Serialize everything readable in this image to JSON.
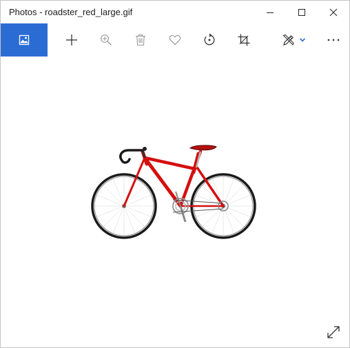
{
  "window": {
    "title": "Photos - roadster_red_large.gif",
    "controls": [
      "minimize-icon",
      "maximize-icon",
      "close-icon"
    ]
  },
  "toolbar": {
    "buttons": [
      {
        "name": "photos-home",
        "icon": "image-icon"
      },
      {
        "name": "add",
        "icon": "plus-icon"
      },
      {
        "name": "zoom",
        "icon": "zoom-in-icon"
      },
      {
        "name": "delete",
        "icon": "trash-icon"
      },
      {
        "name": "favorite",
        "icon": "heart-icon"
      },
      {
        "name": "rotate",
        "icon": "rotate-icon"
      },
      {
        "name": "crop",
        "icon": "crop-icon"
      },
      {
        "name": "edit-create",
        "icon": "pen-brush-icon"
      },
      {
        "name": "see-more",
        "icon": "more-icon"
      }
    ]
  },
  "colors": {
    "accent": "#2b6cd4",
    "bike_frame": "#d40f0f",
    "icon": "#333333",
    "icon_disabled": "#9a9a9a"
  },
  "photo": {
    "subject": "red road bicycle"
  }
}
